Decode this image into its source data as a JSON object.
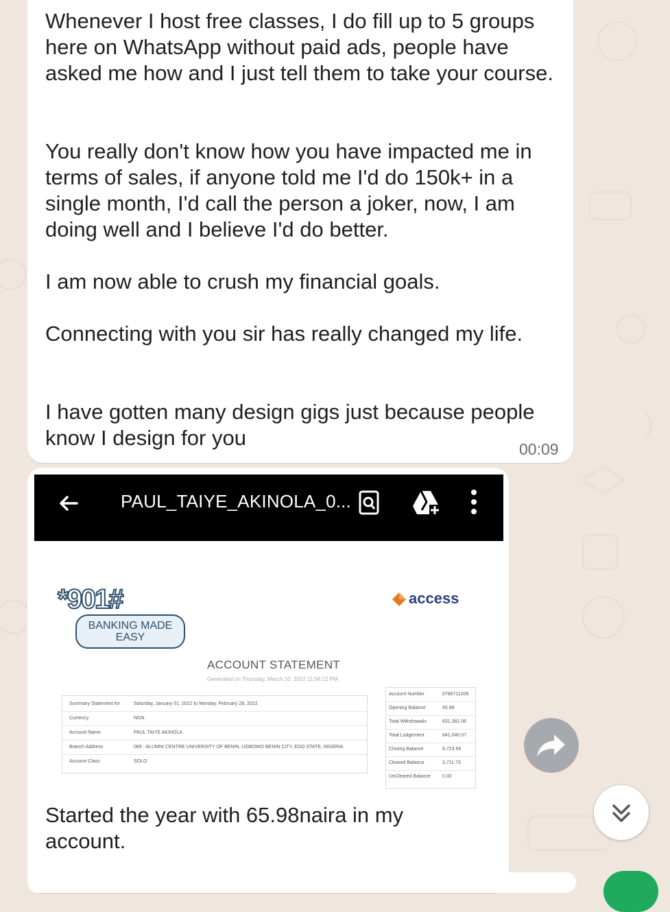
{
  "messages": [
    {
      "paragraphs": [
        "Whenever I host free classes, I do fill up to 5 groups here on WhatsApp without paid ads, people have asked me how and I just tell them to take your course.",
        "You really don't know how you have impacted me in terms of sales, if anyone told me I'd do 150k+ in a single month, I'd call the person a joker, now, I am doing well and I believe I'd do better.",
        "I am now able to crush my financial goals.",
        "Connecting with you sir has really changed my life.",
        "I have gotten many design gigs just because people know I design for you"
      ],
      "time": "00:09"
    },
    {
      "image": {
        "file_title": "PAUL_TAIYE_AKINOLA_0...",
        "bank_logo_number": "*901#",
        "bank_logo_tagline": "BANKING MADE EASY",
        "bank_name": "access",
        "statement_title": "ACCOUNT STATEMENT",
        "generated_on": "Generated on Thursday, March 10, 2022 11:56:22 PM",
        "summary_rows": [
          {
            "label": "Summary Statement for",
            "value": "Saturday, January 01, 2022 to Monday, February 28, 2022"
          },
          {
            "label": "Currency",
            "value": "NGN"
          },
          {
            "label": "Account Name",
            "value": "PAUL TAIYE AKINOLA"
          },
          {
            "label": "Branch Address",
            "value": "069 - ALUMNI CENTRE UNIVERSITY OF BENIN, UGBOWO BENIN CITY, EDO STATE, NIGERIA"
          },
          {
            "label": "Account Class",
            "value": "SOLO"
          }
        ],
        "balance_rows": [
          {
            "label": "Account Number",
            "value": "0786711209"
          },
          {
            "label": "Opening Balance",
            "value": "65.98"
          },
          {
            "label": "Total Withdrawals",
            "value": "831,382.06"
          },
          {
            "label": "Total Lodgement",
            "value": "841,040.07"
          },
          {
            "label": "Closing Balance",
            "value": "9,723.99"
          },
          {
            "label": "Cleared Balance",
            "value": "3,711.73"
          },
          {
            "label": "UnCleared Balance",
            "value": "0.00"
          }
        ]
      },
      "caption": "Started the year with 65.98naira in my account."
    }
  ],
  "icons": {
    "back": "arrow-left-icon",
    "document_search": "document-search-icon",
    "drive_add": "drive-add-icon",
    "more": "more-vertical-icon",
    "forward": "forward-icon",
    "scroll_down": "double-chevron-down-icon"
  },
  "colors": {
    "wallpaper": "#efe7dd",
    "bubble": "#ffffff",
    "text": "#1f1f1f",
    "timestamp": "#6b6b6b",
    "image_toolbar": "#000000",
    "access_brand": "#2b3f7a",
    "access_orange": "#e87722"
  }
}
